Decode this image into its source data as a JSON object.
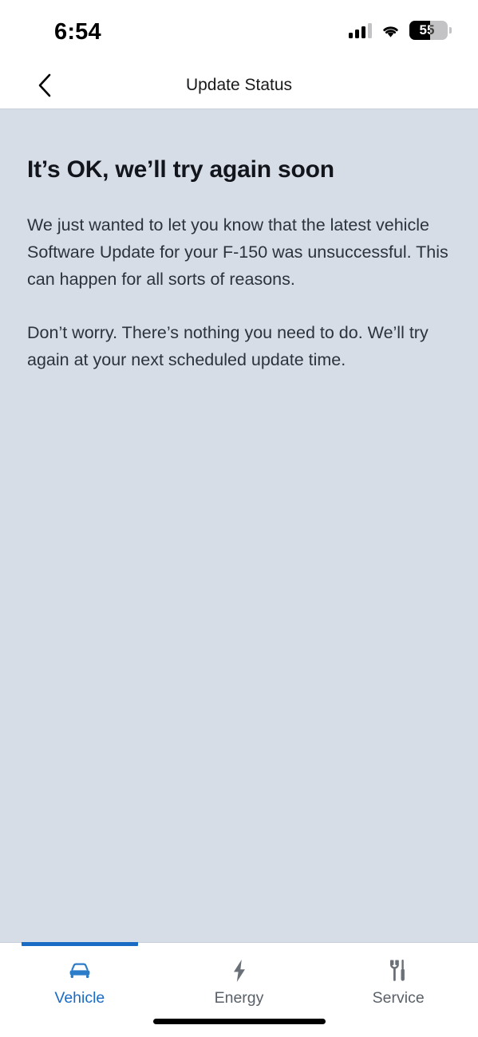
{
  "status_bar": {
    "time": "6:54",
    "cellular_icon": "cellular-signal-icon",
    "cellular_bars_filled": 3,
    "cellular_bars_total": 4,
    "wifi_icon": "wifi-icon",
    "battery_icon": "battery-icon",
    "battery_percent": "55",
    "battery_level": 55
  },
  "nav": {
    "back_icon": "chevron-left-icon",
    "title": "Update Status"
  },
  "main": {
    "headline": "It’s OK, we’ll try again soon",
    "paragraph_1": "We just wanted to let you know that the latest vehicle Software Update for your F-150 was unsuccessful. This can happen for all sorts of reasons.",
    "paragraph_2": "Don’t worry. There’s nothing you need to do. We’ll try again at your next scheduled update time."
  },
  "tab_bar": {
    "active_index": 0,
    "items": [
      {
        "label": "Vehicle",
        "icon": "car-front-icon",
        "active": true
      },
      {
        "label": "Energy",
        "icon": "lightning-bolt-icon",
        "active": false
      },
      {
        "label": "Service",
        "icon": "wrench-screwdriver-icon",
        "active": false
      }
    ]
  },
  "colors": {
    "accent_blue": "#1a6bc4",
    "content_background": "#d7dde7",
    "surface_white": "#ffffff",
    "body_text": "#2c333c",
    "headline_text": "#12161c",
    "inactive_tab": "#5a6068"
  }
}
